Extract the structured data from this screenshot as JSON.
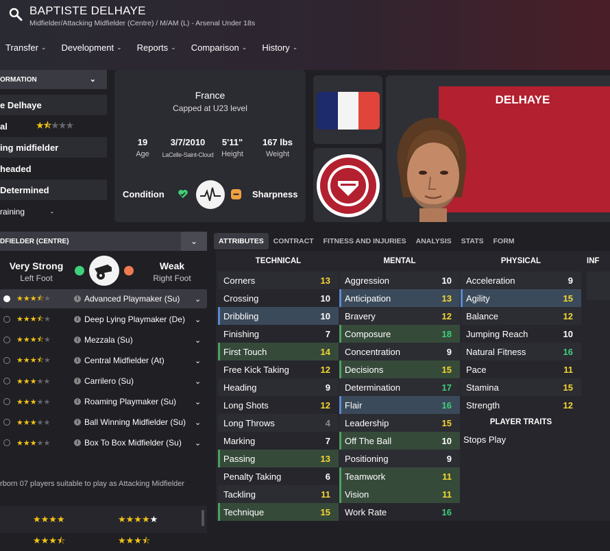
{
  "header": {
    "name": "BAPTISTE DELHAYE",
    "subtitle": "Midfielder/Attacking Midfielder (Centre) / M/AM (L) - Arsenal Under 18s",
    "nav": [
      "Transfer",
      "Development",
      "Reports",
      "Comparison",
      "History"
    ]
  },
  "info": {
    "heading": "ORMATION",
    "rows": [
      "e Delhaye",
      "al",
      "ing midfielder",
      "headed",
      "Determined",
      "raining"
    ],
    "potential_stars": 1.5,
    "training_value": "-"
  },
  "bio": {
    "country": "France",
    "capped": "Capped at U23 level",
    "age_val": "19",
    "age_lab": "Age",
    "dob_val": "3/7/2010",
    "dob_lab": "LaCelle-Saint-Cloud",
    "height_val": "5'11\"",
    "height_lab": "Height",
    "weight_val": "167 lbs",
    "weight_lab": "Weight",
    "condition": "Condition",
    "sharpness": "Sharpness"
  },
  "photo": {
    "name": "DELHAYE"
  },
  "role": {
    "heading": "DFIELDER (CENTRE)",
    "left_foot_strength": "Very Strong",
    "left_foot_label": "Left Foot",
    "right_foot_strength": "Weak",
    "right_foot_label": "Right Foot",
    "roles": [
      {
        "name": "Advanced Playmaker (Su)",
        "stars": 3.5
      },
      {
        "name": "Deep Lying Playmaker (De)",
        "stars": 3.5
      },
      {
        "name": "Mezzala (Su)",
        "stars": 3.5
      },
      {
        "name": "Central Midfielder (At)",
        "stars": 3.5
      },
      {
        "name": "Carrilero (Su)",
        "stars": 3
      },
      {
        "name": "Roaming Playmaker (Su)",
        "stars": 3
      },
      {
        "name": "Ball Winning Midfielder (Su)",
        "stars": 3
      },
      {
        "name": "Box To Box Midfielder (Su)",
        "stars": 3
      }
    ],
    "note": "rborn 07 players suitable to play as Attacking Midfielder",
    "bottom_stars": [
      4,
      5,
      3.5,
      3.5
    ]
  },
  "tabs": [
    "ATTRIBUTES",
    "CONTRACT",
    "FITNESS AND INJURIES",
    "ANALYSIS",
    "STATS",
    "FORM"
  ],
  "attributes": {
    "technical_head": "TECHNICAL",
    "mental_head": "MENTAL",
    "physical_head": "PHYSICAL",
    "inf_head": "INF",
    "technical": [
      {
        "n": "Corners",
        "v": 13,
        "hl": ""
      },
      {
        "n": "Crossing",
        "v": 10,
        "hl": ""
      },
      {
        "n": "Dribbling",
        "v": 10,
        "hl": "blue"
      },
      {
        "n": "Finishing",
        "v": 7,
        "hl": ""
      },
      {
        "n": "First Touch",
        "v": 14,
        "hl": "green"
      },
      {
        "n": "Free Kick Taking",
        "v": 12,
        "hl": ""
      },
      {
        "n": "Heading",
        "v": 9,
        "hl": ""
      },
      {
        "n": "Long Shots",
        "v": 12,
        "hl": ""
      },
      {
        "n": "Long Throws",
        "v": 4,
        "hl": ""
      },
      {
        "n": "Marking",
        "v": 7,
        "hl": ""
      },
      {
        "n": "Passing",
        "v": 13,
        "hl": "green"
      },
      {
        "n": "Penalty Taking",
        "v": 6,
        "hl": ""
      },
      {
        "n": "Tackling",
        "v": 11,
        "hl": ""
      },
      {
        "n": "Technique",
        "v": 15,
        "hl": "green"
      }
    ],
    "mental": [
      {
        "n": "Aggression",
        "v": 10,
        "hl": ""
      },
      {
        "n": "Anticipation",
        "v": 13,
        "hl": "blue"
      },
      {
        "n": "Bravery",
        "v": 12,
        "hl": ""
      },
      {
        "n": "Composure",
        "v": 18,
        "hl": "green"
      },
      {
        "n": "Concentration",
        "v": 9,
        "hl": ""
      },
      {
        "n": "Decisions",
        "v": 15,
        "hl": "green"
      },
      {
        "n": "Determination",
        "v": 17,
        "hl": ""
      },
      {
        "n": "Flair",
        "v": 16,
        "hl": "blue"
      },
      {
        "n": "Leadership",
        "v": 15,
        "hl": ""
      },
      {
        "n": "Off The Ball",
        "v": 10,
        "hl": "green"
      },
      {
        "n": "Positioning",
        "v": 9,
        "hl": ""
      },
      {
        "n": "Teamwork",
        "v": 11,
        "hl": "green"
      },
      {
        "n": "Vision",
        "v": 11,
        "hl": "green"
      },
      {
        "n": "Work Rate",
        "v": 16,
        "hl": ""
      }
    ],
    "physical": [
      {
        "n": "Acceleration",
        "v": 9,
        "hl": ""
      },
      {
        "n": "Agility",
        "v": 15,
        "hl": "blue"
      },
      {
        "n": "Balance",
        "v": 12,
        "hl": ""
      },
      {
        "n": "Jumping Reach",
        "v": 10,
        "hl": ""
      },
      {
        "n": "Natural Fitness",
        "v": 16,
        "hl": ""
      },
      {
        "n": "Pace",
        "v": 11,
        "hl": ""
      },
      {
        "n": "Stamina",
        "v": 15,
        "hl": ""
      },
      {
        "n": "Strength",
        "v": 12,
        "hl": ""
      }
    ],
    "traits_head": "PLAYER TRAITS",
    "traits": [
      "Stops Play"
    ]
  }
}
